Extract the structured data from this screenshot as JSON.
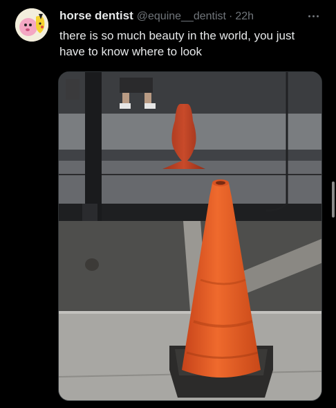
{
  "post": {
    "display_name": "horse dentist",
    "handle": "@equine__dentist",
    "separator": "·",
    "time": "22h",
    "text_line1": "there is so much beauty in the world, you just",
    "text_line2": "have to know where to look"
  },
  "icons": {
    "more": "more-horizontal-icon"
  },
  "colors": {
    "background": "#000000",
    "primary_text": "#e7e9ea",
    "secondary_text": "#71767b",
    "cone_orange": "#e8581f"
  }
}
